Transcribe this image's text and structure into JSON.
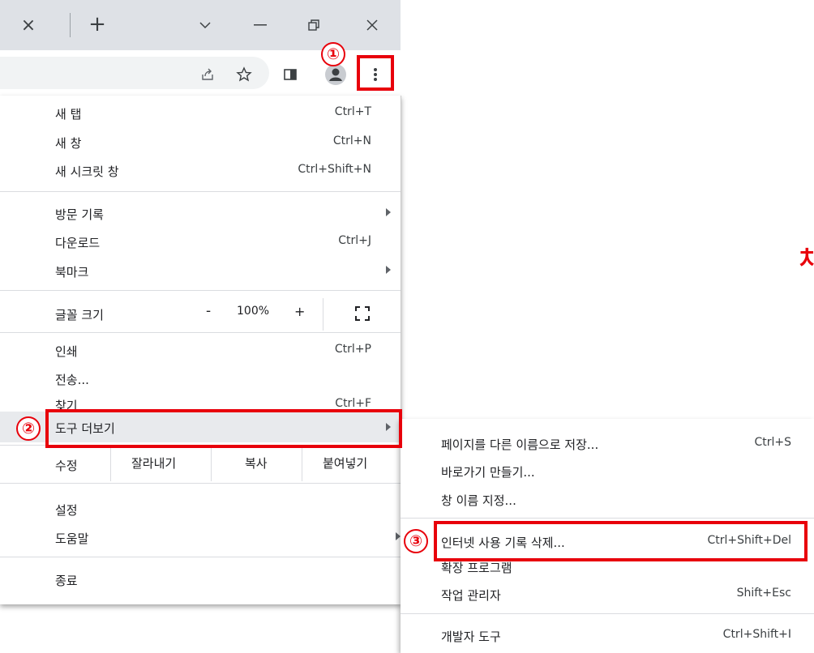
{
  "tabstrip": {
    "close_tab_glyph": "×",
    "new_tab_glyph": "+",
    "icons": [
      "close-icon",
      "plus-icon",
      "chevron-down-icon",
      "minimize-icon",
      "restore-icon",
      "close-window-icon"
    ]
  },
  "toolbar": {
    "icons": [
      "share-icon",
      "star-icon",
      "side-panel-icon",
      "profile-icon",
      "more-vert-icon"
    ]
  },
  "menu": {
    "new_tab": {
      "label": "새 탭",
      "shortcut": "Ctrl+T"
    },
    "new_window": {
      "label": "새 창",
      "shortcut": "Ctrl+N"
    },
    "incognito": {
      "label": "새 시크릿 창",
      "shortcut": "Ctrl+Shift+N"
    },
    "history": {
      "label": "방문 기록"
    },
    "downloads": {
      "label": "다운로드",
      "shortcut": "Ctrl+J"
    },
    "bookmarks": {
      "label": "북마크"
    },
    "zoom": {
      "label": "글꼴 크기",
      "minus": "-",
      "value": "100%",
      "plus": "+"
    },
    "print": {
      "label": "인쇄",
      "shortcut": "Ctrl+P"
    },
    "cast": {
      "label": "전송..."
    },
    "find": {
      "label": "찾기",
      "shortcut": "Ctrl+F"
    },
    "more_tools": {
      "label": "도구 더보기"
    },
    "edit": {
      "label": "수정",
      "cut": "잘라내기",
      "copy": "복사",
      "paste": "붙여넣기"
    },
    "settings": {
      "label": "설정"
    },
    "help": {
      "label": "도움말"
    },
    "exit": {
      "label": "종료"
    }
  },
  "submenu": {
    "save_as": {
      "label": "페이지를 다른 이름으로 저장...",
      "shortcut": "Ctrl+S"
    },
    "create_shortcut": {
      "label": "바로가기 만들기..."
    },
    "name_window": {
      "label": "창 이름 지정..."
    },
    "clear_data": {
      "label": "인터넷 사용 기록 삭제...",
      "shortcut": "Ctrl+Shift+Del"
    },
    "extensions": {
      "label": "확장 프로그램"
    },
    "task_manager": {
      "label": "작업 관리자",
      "shortcut": "Shift+Esc"
    },
    "dev_tools": {
      "label": "개발자 도구",
      "shortcut": "Ctrl+Shift+I"
    }
  },
  "annotations": {
    "step1": "①",
    "step2": "②",
    "step3": "③",
    "highlight_color": "#e8000b"
  },
  "background": {
    "fragment": "차"
  }
}
